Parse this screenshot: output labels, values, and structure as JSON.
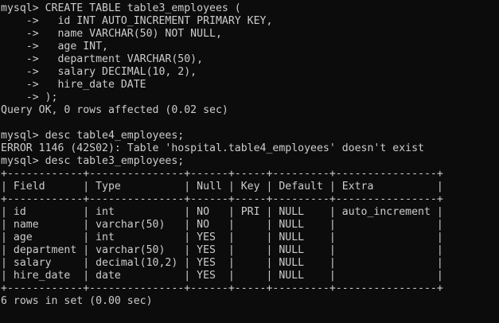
{
  "terminal": {
    "lines": [
      "mysql> CREATE TABLE table3_employees (",
      "    ->   id INT AUTO_INCREMENT PRIMARY KEY,",
      "    ->   name VARCHAR(50) NOT NULL,",
      "    ->   age INT,",
      "    ->   department VARCHAR(50),",
      "    ->   salary DECIMAL(10, 2),",
      "    ->   hire_date DATE",
      "    -> );",
      "Query OK, 0 rows affected (0.02 sec)",
      "",
      "mysql> desc table4_employees;",
      "ERROR 1146 (42S02): Table 'hospital.table4_employees' doesn't exist",
      "mysql> desc table3_employees;",
      "+------------+---------------+------+-----+---------+----------------+",
      "| Field      | Type          | Null | Key | Default | Extra          |",
      "+------------+---------------+------+-----+---------+----------------+",
      "| id         | int           | NO   | PRI | NULL    | auto_increment |",
      "| name       | varchar(50)   | NO   |     | NULL    |                |",
      "| age        | int           | YES  |     | NULL    |                |",
      "| department | varchar(50)   | YES  |     | NULL    |                |",
      "| salary     | decimal(10,2) | YES  |     | NULL    |                |",
      "| hire_date  | date          | YES  |     | NULL    |                |",
      "+------------+---------------+------+-----+---------+----------------+",
      "6 rows in set (0.00 sec)"
    ]
  }
}
